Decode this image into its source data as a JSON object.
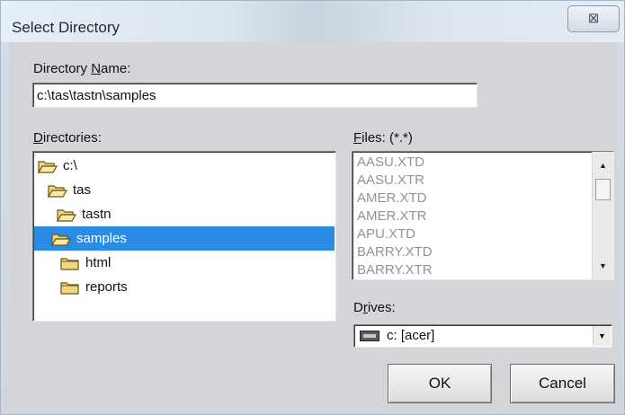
{
  "window": {
    "title": "Select Directory",
    "close_glyph": "⊠"
  },
  "directory_name": {
    "label_prefix": "Directory ",
    "label_accel": "N",
    "label_suffix": "ame:",
    "value": "c:\\tas\\tastn\\samples"
  },
  "directories": {
    "label_accel": "D",
    "label_suffix": "irectories:",
    "items": [
      {
        "label": "c:\\",
        "icon": "open-folder-icon",
        "selected": false
      },
      {
        "label": "tas",
        "icon": "open-folder-icon",
        "selected": false
      },
      {
        "label": "tastn",
        "icon": "open-folder-icon",
        "selected": false
      },
      {
        "label": "samples",
        "icon": "open-folder-icon",
        "selected": true
      },
      {
        "label": "html",
        "icon": "closed-folder-icon",
        "selected": false
      },
      {
        "label": "reports",
        "icon": "closed-folder-icon",
        "selected": false
      }
    ]
  },
  "files": {
    "label_accel": "F",
    "label_suffix": "iles: (*.*)",
    "items": [
      "AASU.XTD",
      "AASU.XTR",
      "AMER.XTD",
      "AMER.XTR",
      "APU.XTD",
      "BARRY.XTD",
      "BARRY.XTR"
    ]
  },
  "drives": {
    "label_prefix": "D",
    "label_accel": "r",
    "label_suffix": "ives:",
    "selected": "c: [acer]",
    "icon": "hard-drive-icon"
  },
  "buttons": {
    "ok": "OK",
    "cancel": "Cancel"
  },
  "colors": {
    "selection": "#2a8ce4",
    "folder": "#f3d77e"
  }
}
